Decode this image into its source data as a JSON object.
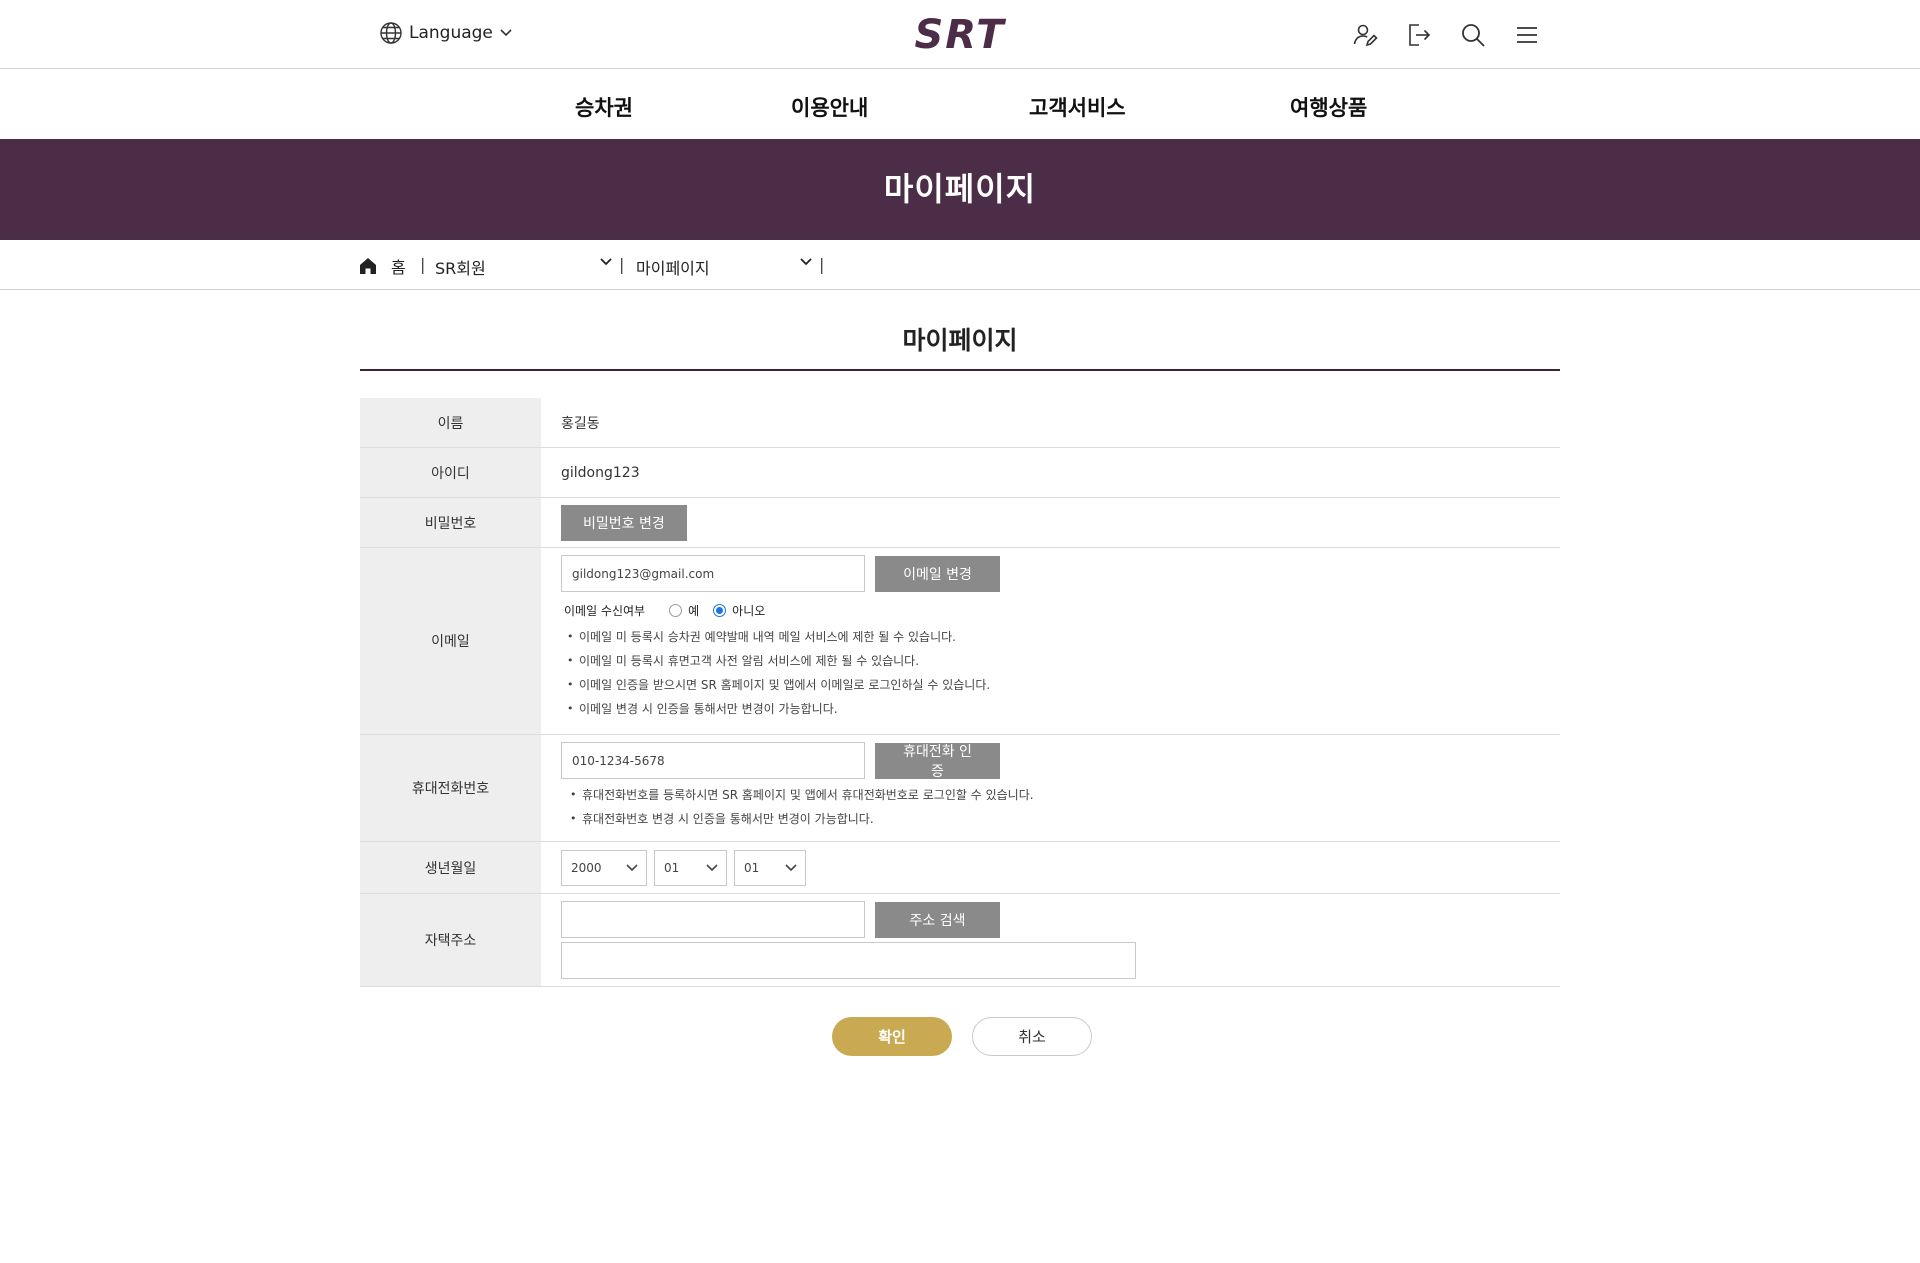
{
  "header": {
    "language_label": "Language",
    "logo_text": "SRT",
    "icons": [
      "user-edit-icon",
      "logout-icon",
      "search-icon",
      "menu-icon"
    ]
  },
  "gnb": [
    "승차권",
    "이용안내",
    "고객서비스",
    "여행상품"
  ],
  "banner": {
    "title": "마이페이지"
  },
  "breadcrumb": {
    "home": "홈",
    "level1": "SR회원",
    "level2": "마이페이지"
  },
  "page": {
    "title": "마이페이지"
  },
  "form": {
    "name": {
      "label": "이름",
      "value": "홍길동"
    },
    "id": {
      "label": "아이디",
      "value": "gildong123"
    },
    "password": {
      "label": "비밀번호",
      "button": "비밀번호 변경"
    },
    "email": {
      "label": "이메일",
      "value": "gildong123@gmail.com",
      "button": "이메일 변경",
      "receive_label": "이메일 수신여부",
      "yes": "예",
      "no": "아니오",
      "selected": "아니오",
      "notes": [
        "이메일 미 등록시 승차권 예약발매 내역 메일 서비스에 제한 될 수 있습니다.",
        "이메일 미 등록시 휴면고객 사전 알림 서비스에 제한 될 수 있습니다.",
        "이메일 인증을 받으시면 SR 홈페이지 및 앱에서 이메일로 로그인하실 수 있습니다.",
        "이메일 변경 시 인증을 통해서만 변경이 가능합니다."
      ]
    },
    "phone": {
      "label": "휴대전화번호",
      "value": "010-1234-5678",
      "button": "휴대전화 인증",
      "notes": [
        "휴대전화번호를 등록하시면 SR 홈페이지 및 앱에서 휴대전화번호로 로그인할 수 있습니다.",
        "휴대전화번호 변경 시 인증을 통해서만 변경이 가능합니다."
      ]
    },
    "birth": {
      "label": "생년월일",
      "year": "2000",
      "month": "01",
      "day": "01"
    },
    "address": {
      "label": "자택주소",
      "button": "주소 검색",
      "zip": "",
      "detail": ""
    }
  },
  "actions": {
    "confirm": "확인",
    "cancel": "취소"
  },
  "colors": {
    "banner": "#4b2d47",
    "confirm": "#c9aa52",
    "gray_button": "#8a8a8a",
    "logo": "#4b2d47"
  }
}
